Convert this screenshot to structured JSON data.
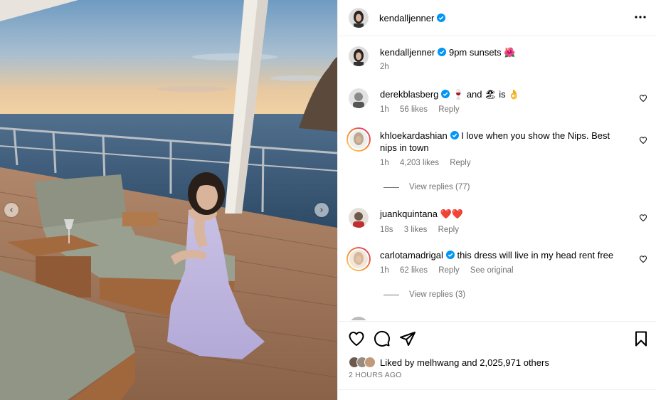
{
  "post": {
    "author": "kendalljenner",
    "more_icon": "more-horizontal-icon"
  },
  "caption": {
    "username": "kendalljenner",
    "text": "9pm sunsets 🌺",
    "time": "2h"
  },
  "comments": [
    {
      "username": "derekblasberg",
      "verified": true,
      "text": "🍷 and 🏖 is 👌",
      "time": "1h",
      "likes": "56 likes",
      "reply": "Reply",
      "avatar_color": "#8a8a8a"
    },
    {
      "username": "khloekardashian",
      "verified": true,
      "text": "I love when you show the Nips. Best nips in town",
      "time": "1h",
      "likes": "4,203 likes",
      "reply": "Reply",
      "view_replies": "View replies (77)",
      "avatar_color": "#b9a98d"
    },
    {
      "username": "juankquintana",
      "verified": false,
      "text": "❤️❤️",
      "time": "18s",
      "likes": "3 likes",
      "reply": "Reply",
      "avatar_color": "#6e5a4a"
    },
    {
      "username": "carlotamadrigal",
      "verified": true,
      "text": "this dress will live in my head rent free",
      "time": "1h",
      "likes": "62 likes",
      "reply": "Reply",
      "see_original": "See original",
      "view_replies": "View replies (3)",
      "avatar_color": "#d7b79a"
    }
  ],
  "likes": {
    "liked_by_prefix": "Liked by",
    "liked_by_user": "melhwang",
    "and_text": "and",
    "others": "2,025,971 others"
  },
  "posted_ago": "2 HOURS AGO",
  "colors": {
    "verified": "#0095f6",
    "story_ring_start": "#feda75",
    "story_ring_end": "#d62976",
    "heart_red": "#ff3040",
    "muted_text": "#737373"
  },
  "icons": {
    "like": "heart-outline-icon",
    "comment": "comment-bubble-icon",
    "share": "paper-plane-icon",
    "save": "bookmark-icon"
  }
}
